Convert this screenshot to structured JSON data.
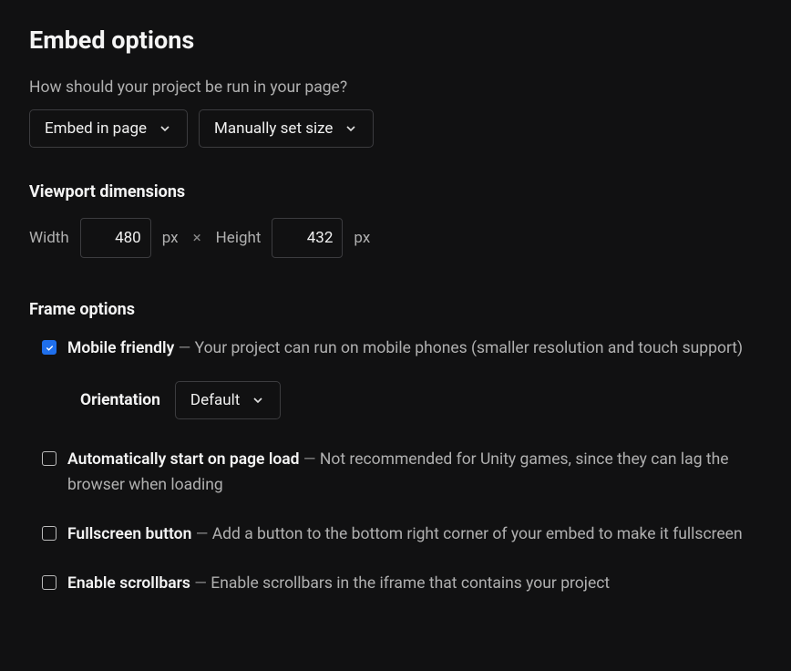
{
  "title": "Embed options",
  "prompt": "How should your project be run in your page?",
  "embed_mode": "Embed in page",
  "size_mode": "Manually set size",
  "viewport": {
    "header": "Viewport dimensions",
    "width_label": "Width",
    "width_value": "480",
    "height_label": "Height",
    "height_value": "432",
    "unit": "px"
  },
  "frame": {
    "header": "Frame options",
    "mobile": {
      "label": "Mobile friendly",
      "desc": "Your project can run on mobile phones (smaller resolution and touch support)",
      "checked": true
    },
    "orientation": {
      "label": "Orientation",
      "value": "Default"
    },
    "autostart": {
      "label": "Automatically start on page load",
      "desc": "Not recommended for Unity games, since they can lag the browser when loading",
      "checked": false
    },
    "fullscreen": {
      "label": "Fullscreen button",
      "desc": "Add a button to the bottom right corner of your embed to make it fullscreen",
      "checked": false
    },
    "scrollbars": {
      "label": "Enable scrollbars",
      "desc": "Enable scrollbars in the iframe that contains your project",
      "checked": false
    }
  }
}
